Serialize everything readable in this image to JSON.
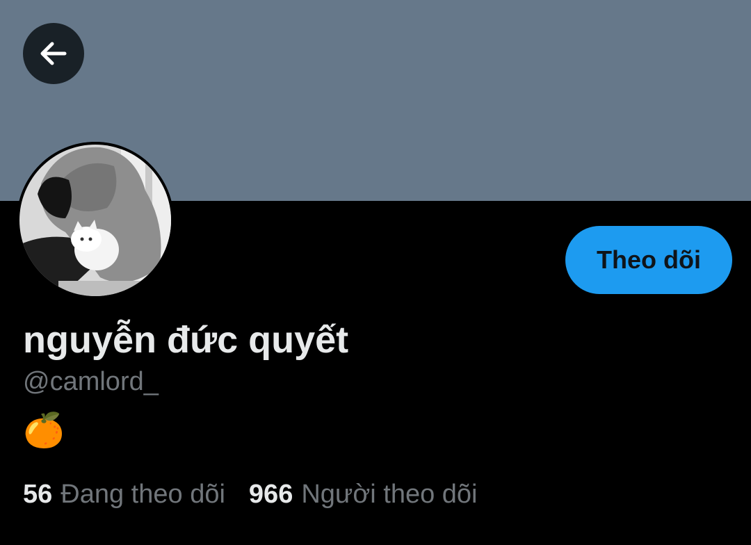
{
  "header": {
    "banner_color": "#66788a",
    "back_icon": "arrow-left-icon"
  },
  "profile": {
    "display_name": "nguyễn đức quyết",
    "handle": "@camlord_",
    "bio": "🍊",
    "follow_button_label": "Theo dõi",
    "accent_color": "#1d9bf0"
  },
  "stats": [
    {
      "count": "56",
      "label": "Đang theo dõi"
    },
    {
      "count": "966",
      "label": "Người theo dõi"
    }
  ]
}
